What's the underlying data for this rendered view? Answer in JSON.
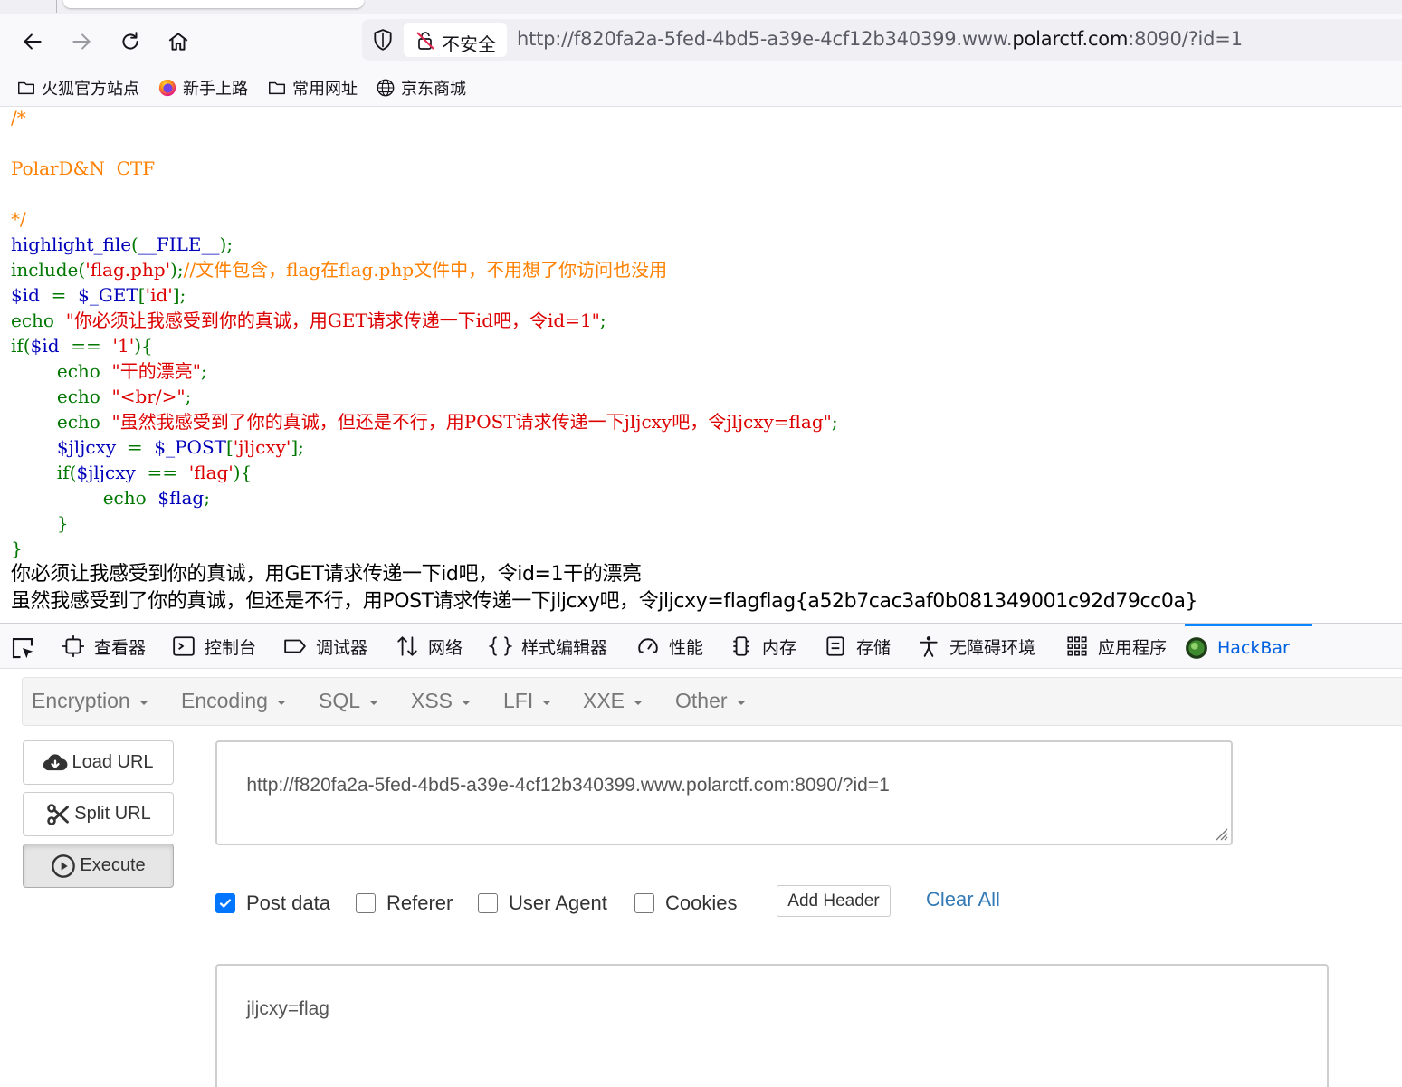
{
  "browser": {
    "security_label": "不安全",
    "url_prefix": "http://f820fa2a-5fed-4bd5-a39e-4cf12b340399.www.",
    "url_domain": "polarctf.com",
    "url_suffix": ":8090/?id=1",
    "bookmarks": [
      {
        "label": "火狐官方站点",
        "icon": "folder-icon"
      },
      {
        "label": "新手上路",
        "icon": "firefox-icon"
      },
      {
        "label": "常用网址",
        "icon": "folder-icon"
      },
      {
        "label": "京东商城",
        "icon": "globe-icon"
      }
    ]
  },
  "source": {
    "l1": "/*",
    "l2": "PolarD&N  CTF",
    "l3": "*/",
    "l4a": "highlight_file",
    "l4b": "(",
    "l4c": "__FILE__",
    "l4d": ");",
    "l5a": "include",
    "l5b": "(",
    "l5c": "'flag.php'",
    "l5d": ");",
    "l5e": "//文件包含，flag在flag.php文件中，不用想了你访问也没用",
    "l6a": "$id",
    "l6b": "  =  ",
    "l6c": "$_GET",
    "l6d": "[",
    "l6e": "'id'",
    "l6f": "];",
    "l7a": "echo  ",
    "l7b": "\"你必须让我感受到你的真诚，用GET请求传递一下id吧，令id=1\"",
    "l7c": ";",
    "l8a": "if(",
    "l8b": "$id",
    "l8c": "  ==  ",
    "l8d": "'1'",
    "l8e": "){",
    "l9a": "        echo  ",
    "l9b": "\"干的漂亮\"",
    "l9c": ";",
    "l10a": "        echo  ",
    "l10b": "\"<br/>\"",
    "l10c": ";",
    "l11a": "        echo  ",
    "l11b": "\"虽然我感受到了你的真诚，但还是不行，用POST请求传递一下jljcxy吧，令jljcxy=flag\"",
    "l11c": ";",
    "l12a": "        $jljcxy",
    "l12b": "  =  ",
    "l12c": "$_POST",
    "l12d": "[",
    "l12e": "'jljcxy'",
    "l12f": "];",
    "l13a": "        if(",
    "l13b": "$jljcxy",
    "l13c": "  ==  ",
    "l13d": "'flag'",
    "l13e": "){",
    "l14a": "                echo  ",
    "l14b": "$flag",
    "l14c": ";",
    "l15": "        }",
    "l16": "}"
  },
  "output": {
    "line1": "你必须让我感受到你的真诚，用GET请求传递一下id吧，令id=1干的漂亮",
    "line2": "虽然我感受到了你的真诚，但还是不行，用POST请求传递一下jljcxy吧，令jljcxy=flagflag{a52b7cac3af0b081349001c92d79cc0a}"
  },
  "devtools": {
    "tabs": [
      {
        "label": "查看器",
        "icon": "inspector-icon"
      },
      {
        "label": "控制台",
        "icon": "console-icon"
      },
      {
        "label": "调试器",
        "icon": "debugger-icon"
      },
      {
        "label": "网络",
        "icon": "network-icon"
      },
      {
        "label": "样式编辑器",
        "icon": "style-editor-icon"
      },
      {
        "label": "性能",
        "icon": "performance-icon"
      },
      {
        "label": "内存",
        "icon": "memory-icon"
      },
      {
        "label": "存储",
        "icon": "storage-icon"
      },
      {
        "label": "无障碍环境",
        "icon": "accessibility-icon"
      },
      {
        "label": "应用程序",
        "icon": "application-icon"
      },
      {
        "label": "HackBar",
        "icon": "hackbar-icon",
        "active": true
      }
    ]
  },
  "hackbar": {
    "menu": [
      "Encryption",
      "Encoding",
      "SQL",
      "XSS",
      "LFI",
      "XXE",
      "Other"
    ],
    "load_url": "Load URL",
    "split_url": "Split URL",
    "execute": "Execute",
    "url_value": "http://f820fa2a-5fed-4bd5-a39e-4cf12b340399.www.polarctf.com:8090/?id=1",
    "post_data_label": "Post data",
    "post_data_checked": true,
    "referer_label": "Referer",
    "referer_checked": false,
    "user_agent_label": "User Agent",
    "user_agent_checked": false,
    "cookies_label": "Cookies",
    "cookies_checked": false,
    "add_header": "Add Header",
    "clear_all": "Clear All",
    "post_body": "jljcxy=flag"
  },
  "colors": {
    "comment": "#ff8000",
    "keyword": "#007700",
    "default": "#0000bb",
    "string": "#dd0000",
    "link": "#337ab7",
    "checkbox": "#0075ff",
    "active_tab": "#0060df"
  }
}
